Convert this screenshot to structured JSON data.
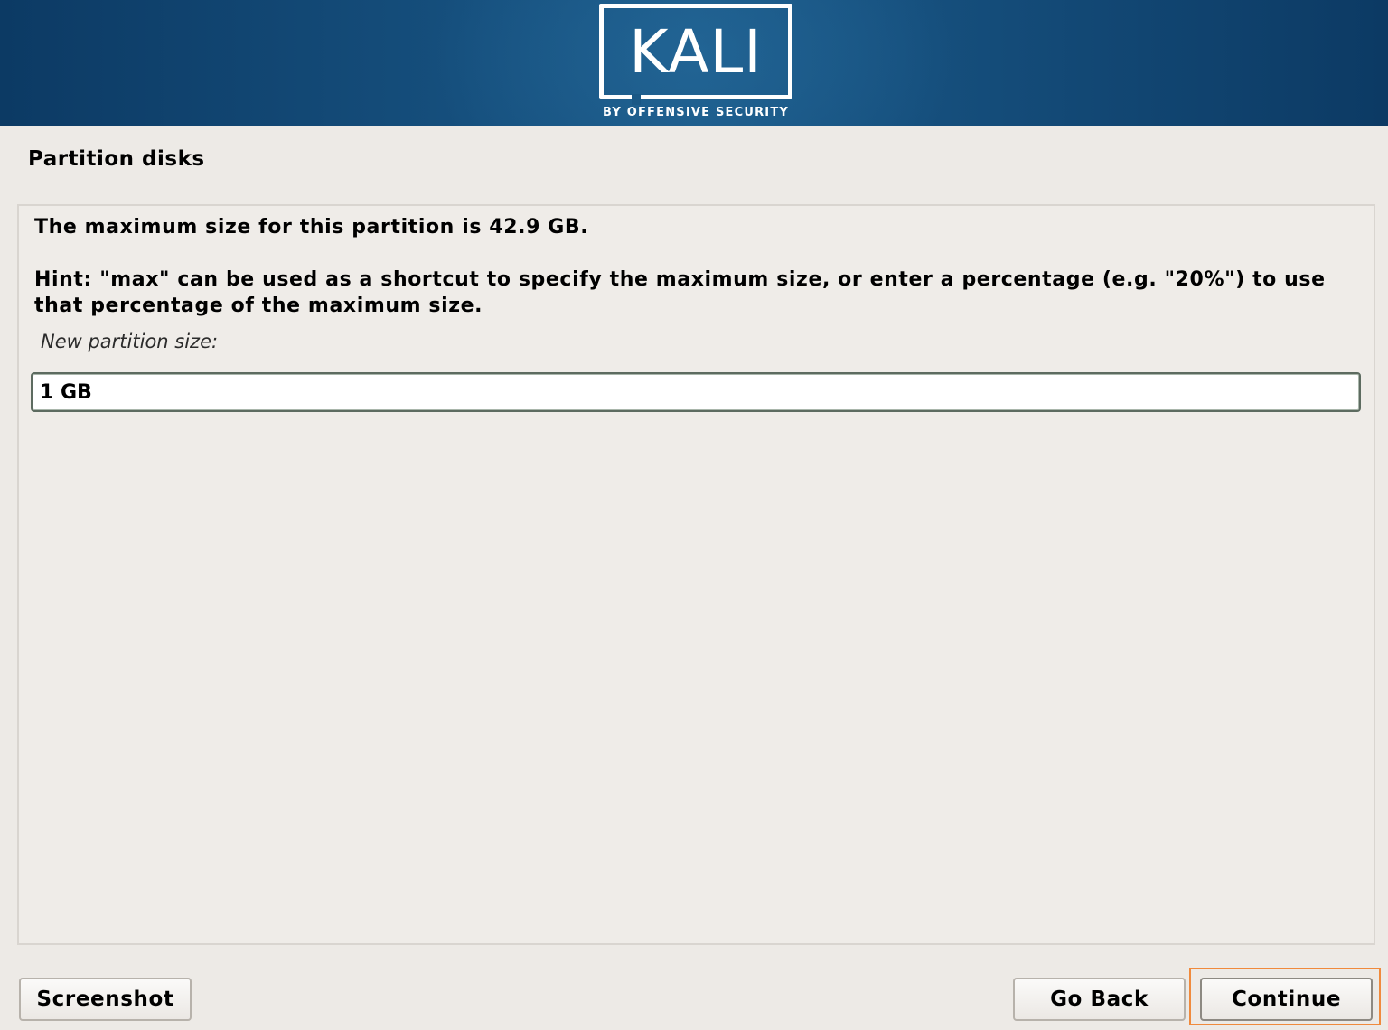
{
  "header": {
    "logo_text": "KALI",
    "logo_subtitle": "BY OFFENSIVE SECURITY"
  },
  "page": {
    "title": "Partition disks"
  },
  "dialog": {
    "max_size_message": "The maximum size for this partition is 42.9 GB.",
    "hint": "Hint: \"max\" can be used as a shortcut to specify the maximum size, or enter a percentage (e.g. \"20%\") to use that percentage of the maximum size.",
    "field_label": "New partition size:",
    "field_value": "1 GB"
  },
  "buttons": {
    "screenshot": "Screenshot",
    "go_back": "Go Back",
    "continue": "Continue"
  },
  "colors": {
    "banner": "#16507e",
    "focus_ring": "#f08a3c",
    "background": "#edeae6"
  }
}
